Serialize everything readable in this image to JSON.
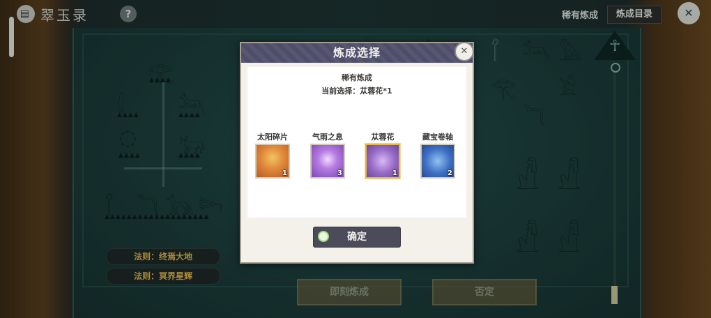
{
  "header": {
    "app_title": "翠玉录",
    "help_symbol": "?",
    "rare_refine_label": "稀有炼成",
    "catalog_button": "炼成目录",
    "close_symbol": "✕"
  },
  "background": {
    "rules": [
      "法则：终焉大地",
      "法则：冥界星辉"
    ],
    "buttons": {
      "refine_now": "即刻炼成",
      "deny": "否定"
    }
  },
  "dialog": {
    "title": "炼成选择",
    "subtitle": "稀有炼成",
    "current_selection": "当前选择：苁蓉花*1",
    "close_symbol": "✕",
    "confirm_label": "确定",
    "items": [
      {
        "name": "太阳碎片",
        "count": "1",
        "selected": false,
        "color": "#e0893a"
      },
      {
        "name": "气雨之息",
        "count": "3",
        "selected": false,
        "color": "#b57be0"
      },
      {
        "name": "苁蓉花",
        "count": "1",
        "selected": true,
        "color": "#9568c6"
      },
      {
        "name": "藏宝卷轴",
        "count": "2",
        "selected": false,
        "color": "#3d6fc4"
      }
    ]
  },
  "colors": {
    "board": "#1c3e3c",
    "dialog_header": "#4e4e6a",
    "rule_text": "#e2b84e",
    "selected_border": "#e8b845"
  }
}
